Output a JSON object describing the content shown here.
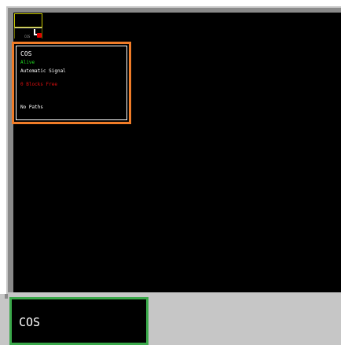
{
  "map": {
    "signal": {
      "label": "COS"
    }
  },
  "info_popup": {
    "name": "COS",
    "status": "Alive",
    "type": "Automatic Signal",
    "blocks": "0 Blocks Free",
    "paths": "No Paths"
  },
  "name_panel": {
    "name": "COS"
  },
  "colors": {
    "popup_border": "#f07c28",
    "name_panel_border": "#3aa84a",
    "status_alive": "#22dd22",
    "blocks_warning": "#e01010",
    "signal_box": "#c8c800",
    "signal_lamp": "#e00000"
  }
}
